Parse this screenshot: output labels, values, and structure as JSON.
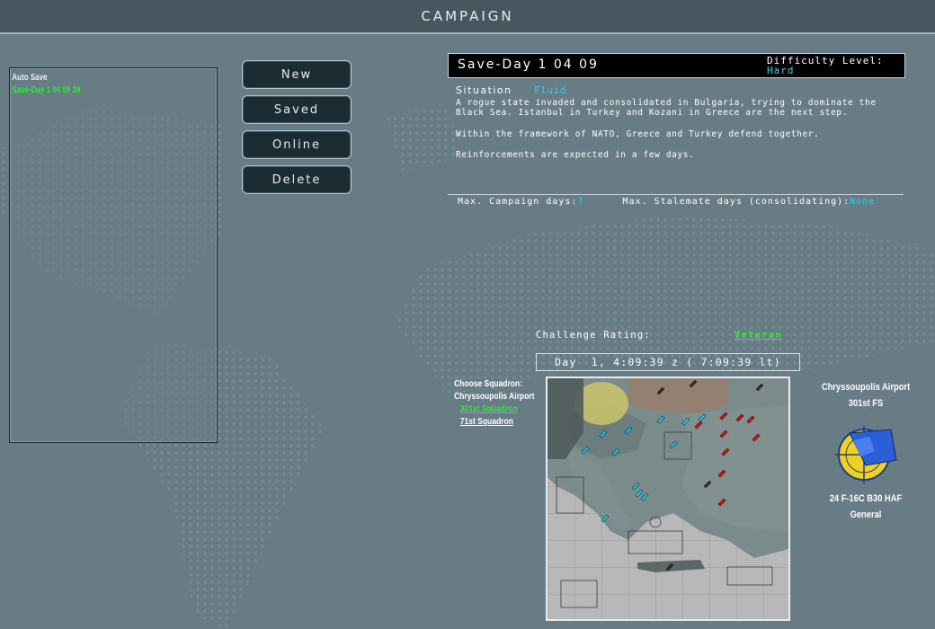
{
  "window": {
    "title": "CAMPAIGN"
  },
  "save_list": {
    "items": [
      {
        "label": "Auto Save",
        "color": "#e8eef0"
      },
      {
        "label": "Save-Day  1 04 09 39",
        "color": "#35e63a"
      }
    ]
  },
  "buttons": {
    "new": "New",
    "saved": "Saved",
    "online": "Online",
    "delete": "Delete"
  },
  "save_header": {
    "title": "Save-Day  1 04 09",
    "difficulty_label": "Difficulty Level:",
    "difficulty_value": "Hard"
  },
  "situation": {
    "heading": "Situation",
    "value": "Fluid",
    "paragraphs": [
      "A rogue state invaded and consolidated in Bulgaria, trying to dominate the Black Sea. Istanbul in Turkey and Kozani in Greece are the next step.",
      "Within the framework of NATO, Greece and Turkey defend together.",
      "Reinforcements are expected in a few days."
    ]
  },
  "campaign_limits": {
    "max_days_label": "Max. Campaign days:",
    "max_days_value": "7",
    "stalemate_label": "Max. Stalemate days (consolidating):",
    "stalemate_value": "None"
  },
  "challenge": {
    "label": "Challenge Rating:",
    "value": "Veteran"
  },
  "day_time": "Day  1, 4:09:39 z ( 7:09:39 lt)",
  "squadron_select": {
    "label": "Choose Squadron:",
    "airport": "Chryssoupolis Airport",
    "squadrons": [
      "301st Squadron",
      "71st Squadron"
    ]
  },
  "unit_info": {
    "airport": "Chryssoupolis Airport",
    "unit": "301st FS",
    "aircraft": "24 F-16C B30 HAF",
    "rank": "General"
  },
  "icons": {
    "emblem": "squadron-emblem-icon",
    "map": "theater-map"
  },
  "colors": {
    "friendly": "#26c6e6",
    "enemy": "#d01a1a",
    "accent_cyan": "#2fd0e0",
    "accent_green": "#35e63a"
  }
}
